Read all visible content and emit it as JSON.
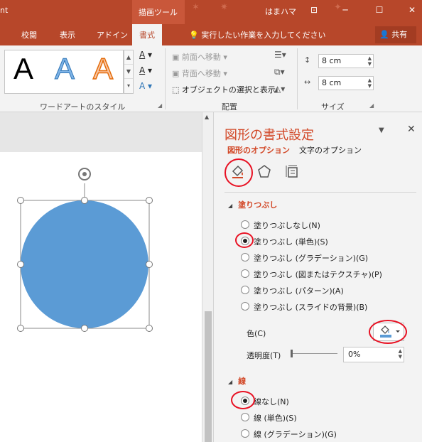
{
  "titlebar": {
    "app_fragment": "nt",
    "context_group": "描画ツール",
    "user": "はまハマ",
    "controls": [
      "ribbon-toggle-icon",
      "minimize-icon",
      "maximize-icon",
      "close-icon"
    ]
  },
  "tabs": {
    "items": [
      "校閲",
      "表示",
      "アドイン",
      "書式"
    ],
    "active": "書式",
    "tell_me": "実行したい作業を入力してください",
    "share": "共有"
  },
  "ribbon": {
    "wordart": {
      "label": "ワードアートのスタイル",
      "samples": [
        "A",
        "A",
        "A"
      ]
    },
    "arrange": {
      "label": "配置",
      "bring_forward": "前面へ移動",
      "send_backward": "背面へ移動",
      "selection_pane": "オブジェクトの選択と表示"
    },
    "size": {
      "label": "サイズ",
      "height": "8 cm",
      "width": "8 cm"
    }
  },
  "pane": {
    "title": "図形の書式設定",
    "tab_shape": "図形のオプション",
    "tab_text": "文字のオプション",
    "fill": {
      "header": "塗りつぶし",
      "options": [
        "塗りつぶしなし(N)",
        "塗りつぶし (単色)(S)",
        "塗りつぶし (グラデーション)(G)",
        "塗りつぶし (図またはテクスチャ)(P)",
        "塗りつぶし (パターン)(A)",
        "塗りつぶし (スライドの背景)(B)"
      ],
      "selected_index": 1,
      "color_label": "色(C)",
      "transparency_label": "透明度(T)",
      "transparency_value": "0%"
    },
    "line": {
      "header": "線",
      "options": [
        "線なし(N)",
        "線 (単色)(S)",
        "線 (グラデーション)(G)"
      ],
      "selected_index": 0
    }
  },
  "colors": {
    "accent": "#b7472a",
    "pane_accent": "#d24726",
    "shape_fill": "#5b9bd5",
    "highlight": "#e81123"
  }
}
